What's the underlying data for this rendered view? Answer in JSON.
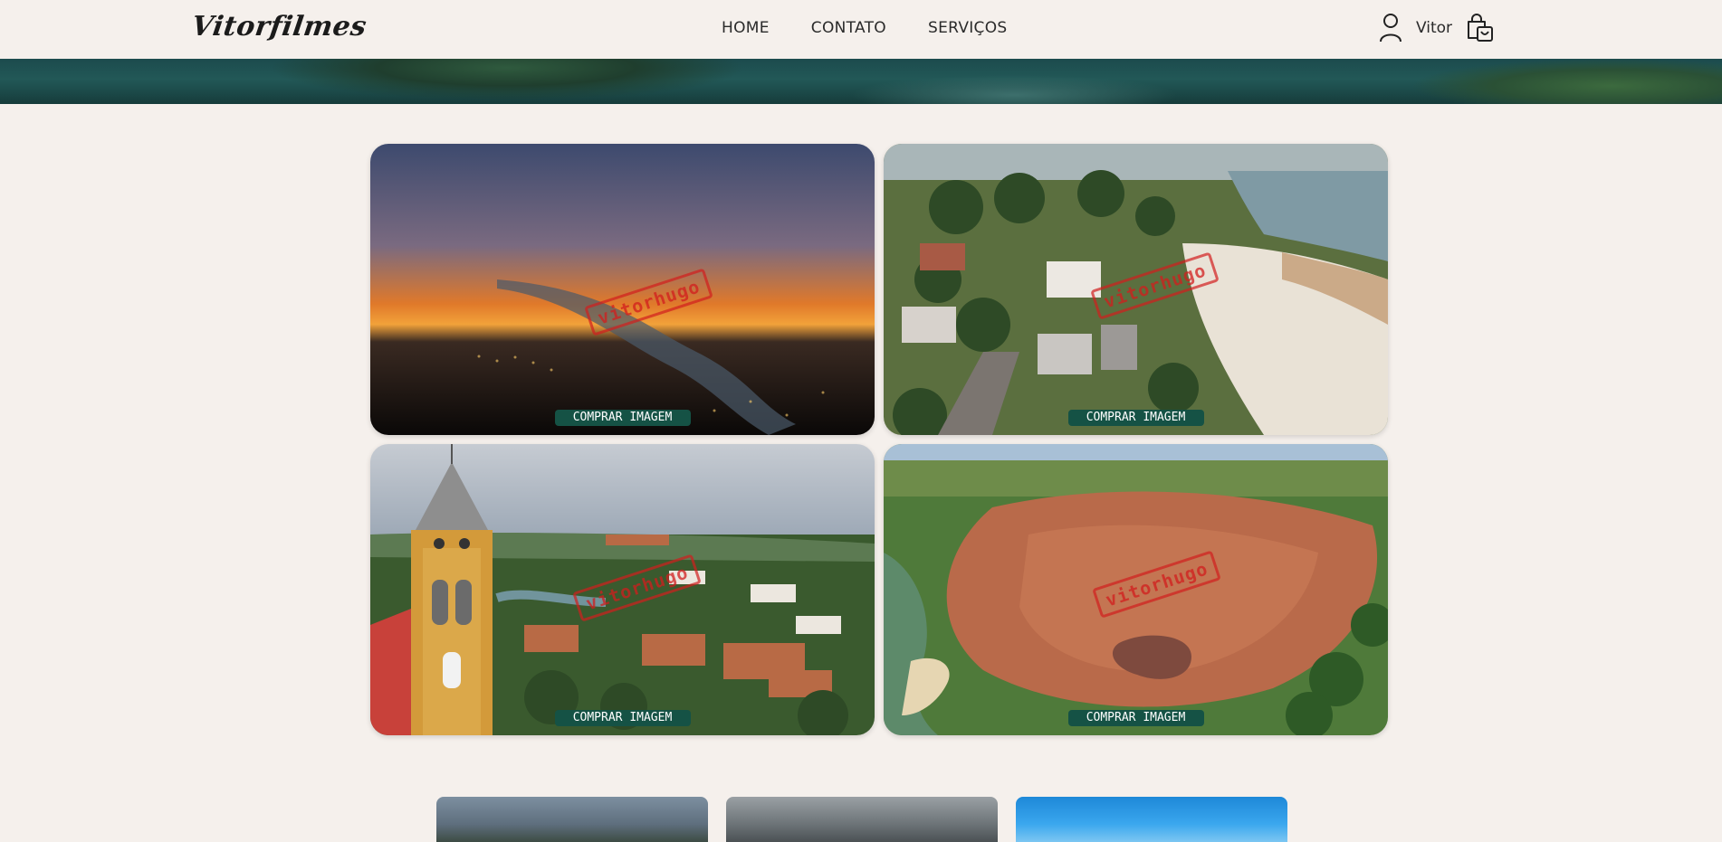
{
  "header": {
    "logo": "Vitorfilmes",
    "nav": [
      {
        "label": "HOME"
      },
      {
        "label": "CONTATO"
      },
      {
        "label": "SERVIÇOS"
      }
    ],
    "user_name": "Vitor",
    "icons": {
      "user": "user-icon",
      "cart": "shopping-bag-icon"
    }
  },
  "gallery": {
    "cards": [
      {
        "scene": "sunset-over-river",
        "watermark": "vitorhugo",
        "button_label": "COMPRAR IMAGEM"
      },
      {
        "scene": "lakeside-beach-town",
        "watermark": "vitorhugo",
        "button_label": "COMPRAR IMAGEM"
      },
      {
        "scene": "church-tower-town",
        "watermark": "vitorhugo",
        "button_label": "COMPRAR IMAGEM"
      },
      {
        "scene": "aerial-town-with-lake",
        "watermark": "vitorhugo",
        "button_label": "COMPRAR IMAGEM"
      }
    ]
  },
  "colors": {
    "background": "#f5f0ec",
    "button": "#155245",
    "button_text": "#ffffff",
    "watermark": "#d21e1e"
  }
}
